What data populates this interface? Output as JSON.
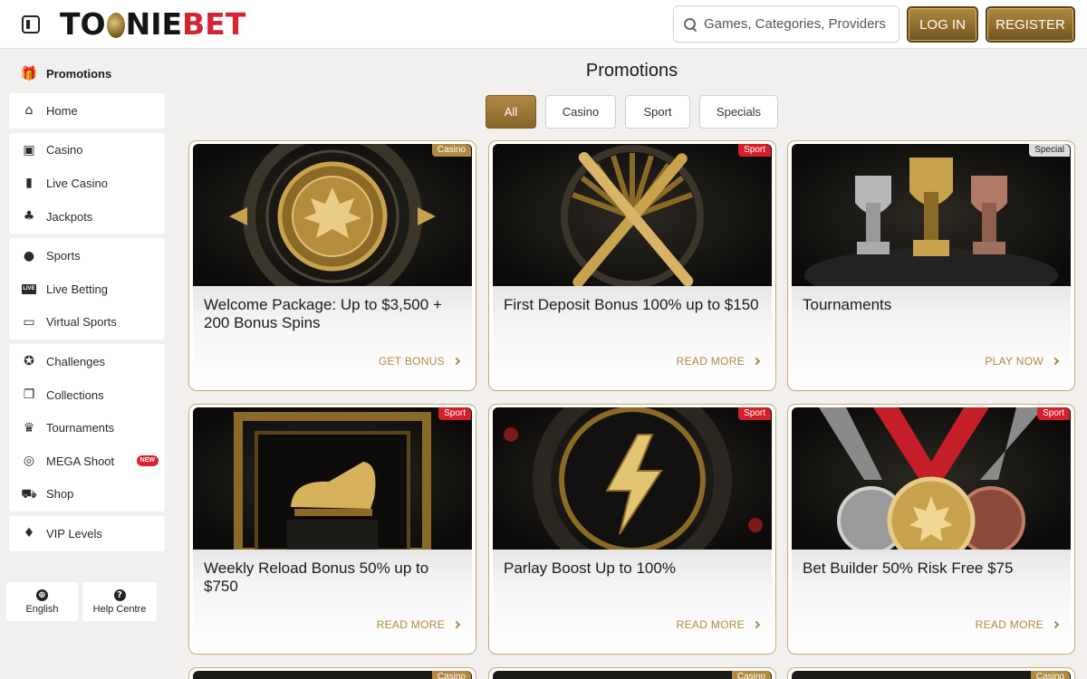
{
  "header": {
    "logo": {
      "part1": "TO",
      "part2": "NIE",
      "part3": "BET"
    },
    "search_placeholder": "Games, Categories, Providers",
    "login_label": "LOG IN",
    "register_label": "REGISTER"
  },
  "sidebar": {
    "top": {
      "label": "Promotions",
      "icon": "gift-icon"
    },
    "groups": [
      [
        {
          "label": "Home",
          "icon": "home-icon"
        }
      ],
      [
        {
          "label": "Casino",
          "icon": "slot-machine-icon"
        },
        {
          "label": "Live Casino",
          "icon": "card-icon"
        },
        {
          "label": "Jackpots",
          "icon": "clover-icon"
        }
      ],
      [
        {
          "label": "Sports",
          "icon": "ball-icon"
        },
        {
          "label": "Live Betting",
          "icon": "live-icon"
        },
        {
          "label": "Virtual Sports",
          "icon": "monitor-icon"
        }
      ],
      [
        {
          "label": "Challenges",
          "icon": "medal-icon"
        },
        {
          "label": "Collections",
          "icon": "cards-icon"
        },
        {
          "label": "Tournaments",
          "icon": "trophy-icon"
        },
        {
          "label": "MEGA Shoot",
          "icon": "target-icon",
          "badge": "NEW"
        },
        {
          "label": "Shop",
          "icon": "cart-icon"
        }
      ],
      [
        {
          "label": "VIP Levels",
          "icon": "diamond-icon"
        }
      ]
    ],
    "bottom": {
      "language_label": "English",
      "help_label": "Help Centre"
    }
  },
  "main": {
    "title": "Promotions",
    "filters": [
      "All",
      "Casino",
      "Sport",
      "Specials"
    ],
    "active_filter": "All",
    "cards": [
      {
        "title": "Welcome Package: Up to $3,500 + 200 Bonus Spins",
        "tag": "Casino",
        "cta": "GET BONUS",
        "image": "coin"
      },
      {
        "title": "First Deposit Bonus 100% up to $150",
        "tag": "Sport",
        "cta": "READ MORE",
        "image": "bats"
      },
      {
        "title": "Tournaments",
        "tag": "Special",
        "cta": "PLAY NOW",
        "image": "trophies"
      },
      {
        "title": "Weekly Reload Bonus 50% up to $750",
        "tag": "Sport",
        "cta": "READ MORE",
        "image": "boot"
      },
      {
        "title": "Parlay Boost Up to 100%",
        "tag": "Sport",
        "cta": "READ MORE",
        "image": "bolt"
      },
      {
        "title": "Bet Builder 50% Risk Free $75",
        "tag": "Sport",
        "cta": "READ MORE",
        "image": "medals"
      }
    ],
    "partial_tags": [
      "Casino",
      "Casino",
      "Casino"
    ]
  },
  "colors": {
    "gold": "#b08a43",
    "red": "#d02532",
    "sport_tag": "#d3202a"
  }
}
